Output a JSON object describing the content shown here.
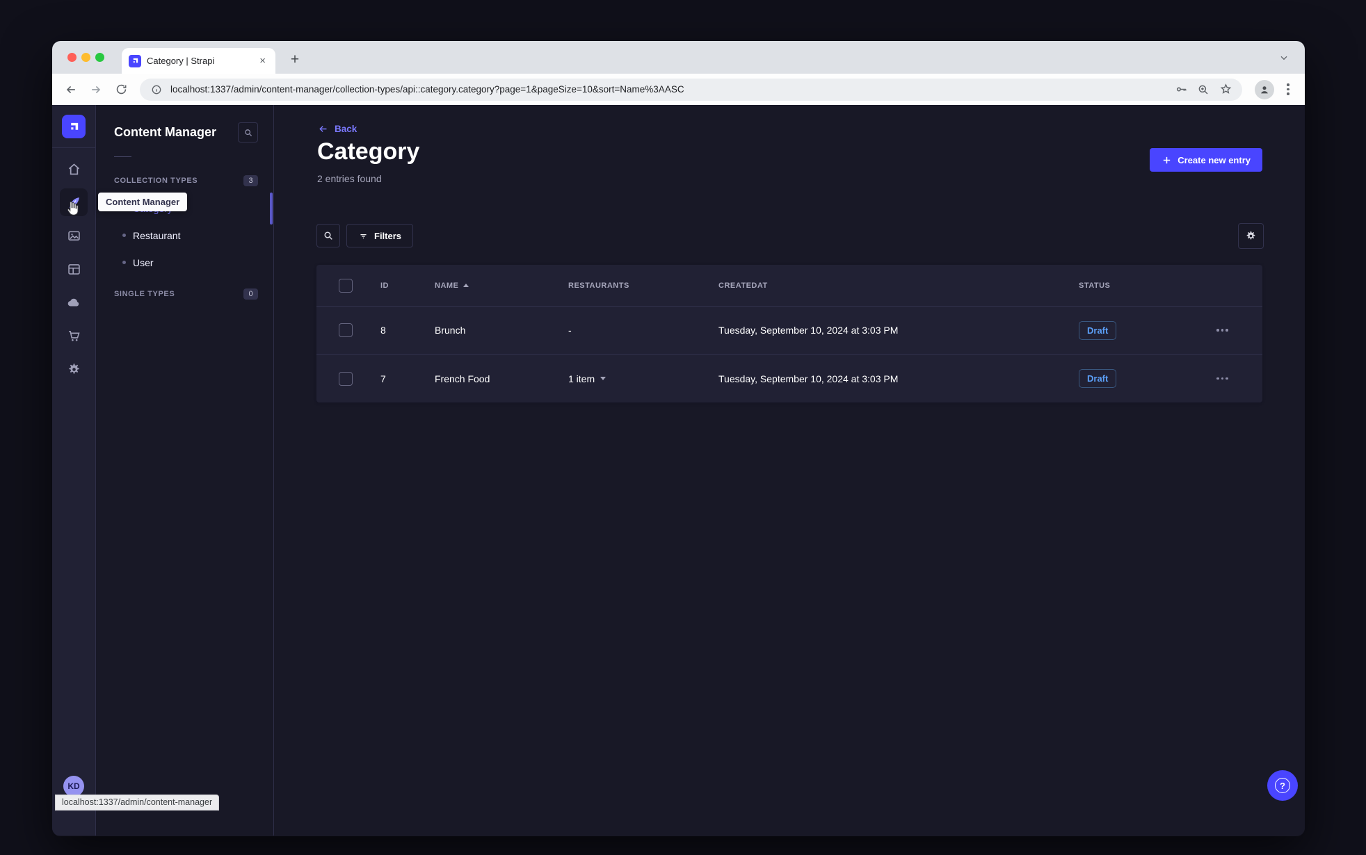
{
  "browser": {
    "tab_title": "Category | Strapi",
    "close_tab_glyph": "×",
    "new_tab_glyph": "+",
    "url": "localhost:1337/admin/content-manager/collection-types/api::category.category?page=1&pageSize=10&sort=Name%3AASC",
    "status_link": "localhost:1337/admin/content-manager"
  },
  "sidebar": {
    "tooltip": "Content Manager",
    "avatar_initials": "KD",
    "icons": [
      "strapi-logo",
      "home",
      "content-manager",
      "media-library",
      "content-type-builder",
      "cloud",
      "marketplace",
      "settings"
    ]
  },
  "subnav": {
    "title": "Content Manager",
    "collection_types": {
      "label": "COLLECTION TYPES",
      "count": "3"
    },
    "items": [
      "Category",
      "Restaurant",
      "User"
    ],
    "single_types": {
      "label": "SINGLE TYPES",
      "count": "0"
    }
  },
  "main": {
    "back_label": "Back",
    "title": "Category",
    "subtitle": "2 entries found",
    "create_button": "Create new entry",
    "filters_label": "Filters",
    "help_label": "?",
    "table": {
      "columns": [
        "ID",
        "NAME",
        "RESTAURANTS",
        "CREATEDAT",
        "STATUS"
      ],
      "rows": [
        {
          "id": "8",
          "name": "Brunch",
          "restaurants": "-",
          "created_at": "Tuesday, September 10, 2024 at 3:03 PM",
          "status": "Draft"
        },
        {
          "id": "7",
          "name": "French Food",
          "restaurants": "1 item",
          "created_at": "Tuesday, September 10, 2024 at 3:03 PM",
          "status": "Draft"
        }
      ]
    }
  },
  "colors": {
    "accent": "#4945ff",
    "link_purple": "#7b79ff",
    "draft_blue": "#5ca0f8",
    "app_bg": "#181826",
    "panel_bg": "#212134",
    "border": "#32324d"
  }
}
